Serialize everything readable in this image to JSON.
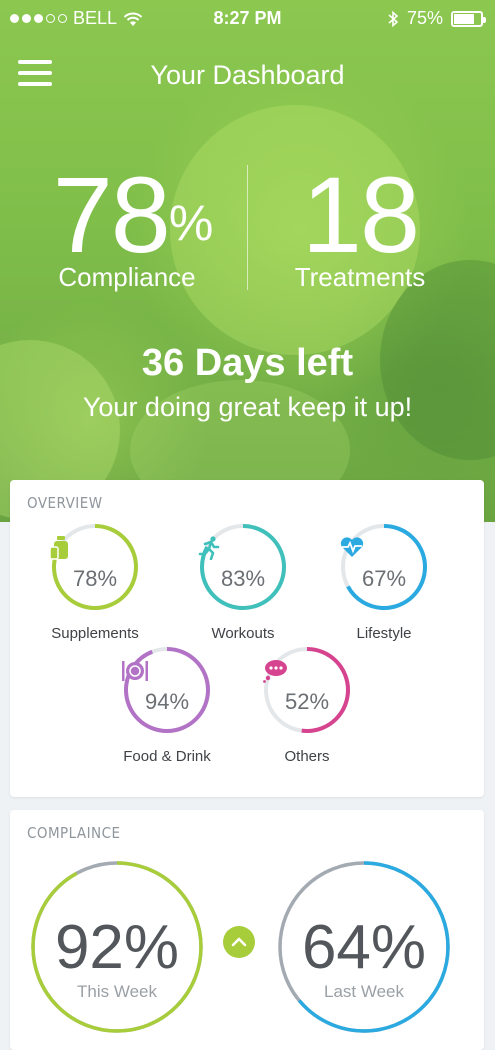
{
  "status_bar": {
    "carrier": "BELL",
    "time": "8:27 PM",
    "battery": "75%",
    "battery_level": 0.75
  },
  "header": {
    "title": "Your Dashboard"
  },
  "stats": {
    "compliance": {
      "value": "78",
      "unit": "%",
      "label": "Compliance"
    },
    "treatments": {
      "value": "18",
      "label": "Treatments"
    }
  },
  "days": {
    "headline": "36 Days left",
    "message": "Your doing great keep it up!"
  },
  "overview": {
    "title": "OVERVIEW",
    "items": [
      {
        "label": "Supplements",
        "value": "78%",
        "percent": 78,
        "color": "#a8cd3a",
        "icon": "pill-bottle-icon"
      },
      {
        "label": "Workouts",
        "value": "83%",
        "percent": 83,
        "color": "#3fc0bb",
        "icon": "runner-icon"
      },
      {
        "label": "Lifestyle",
        "value": "67%",
        "percent": 67,
        "color": "#2aaae0",
        "icon": "heartbeat-icon"
      },
      {
        "label": "Food & Drink",
        "value": "94%",
        "percent": 94,
        "color": "#b272c6",
        "icon": "plate-icon"
      },
      {
        "label": "Others",
        "value": "52%",
        "percent": 52,
        "color": "#d6438f",
        "icon": "chat-bubble-icon"
      }
    ]
  },
  "compliance": {
    "title": "COMPLAINCE",
    "this_week": {
      "value": "92%",
      "label": "This Week",
      "percent": 92,
      "color": "#a8cd3a"
    },
    "last_week": {
      "value": "64%",
      "label": "Last Week",
      "percent": 64,
      "color": "#2aaae0"
    }
  }
}
